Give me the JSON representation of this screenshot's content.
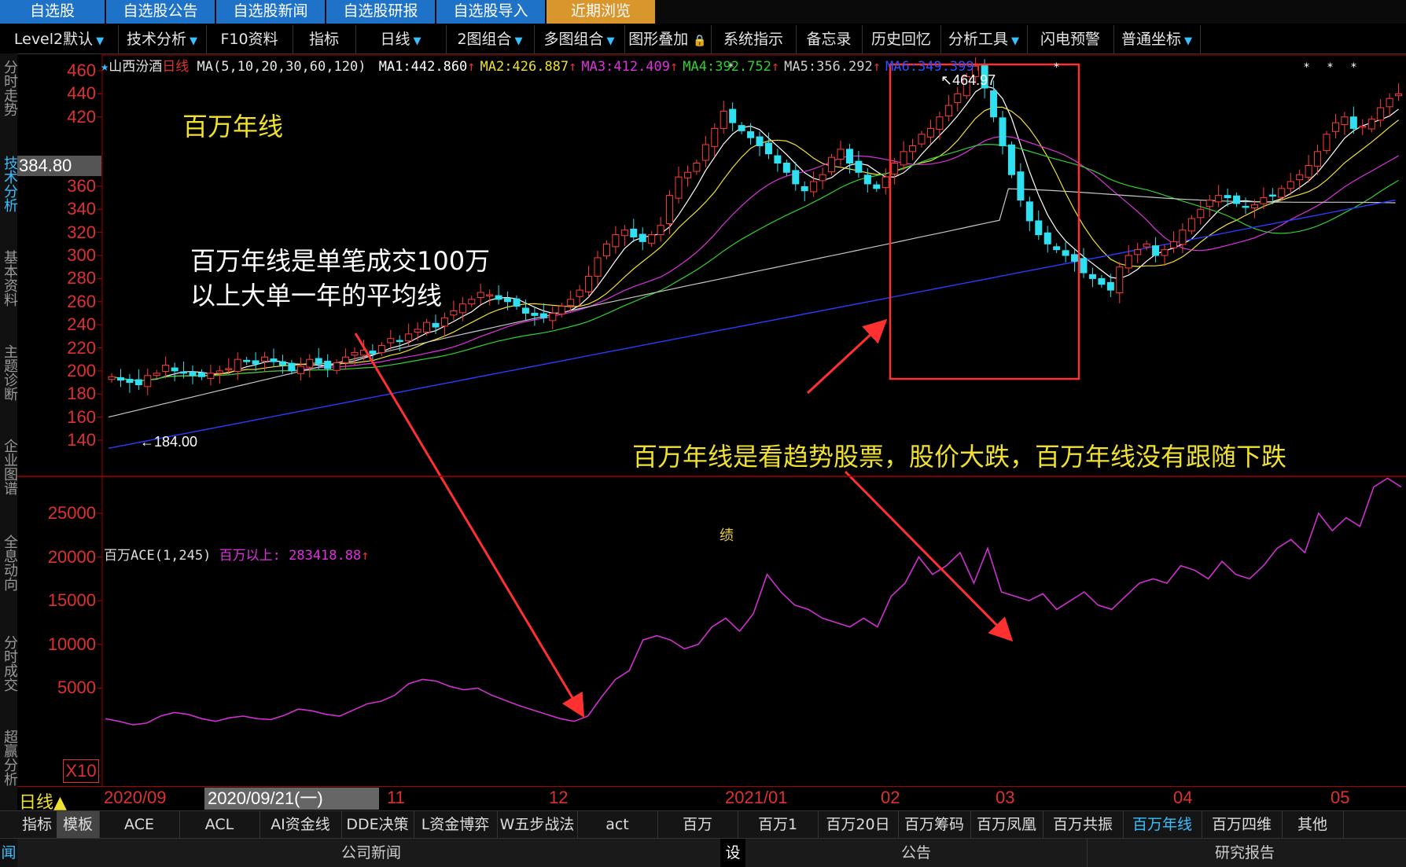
{
  "top_tabs": [
    {
      "label": "自选股",
      "active": false
    },
    {
      "label": "自选股公告",
      "active": false
    },
    {
      "label": "自选股新闻",
      "active": false
    },
    {
      "label": "自选股研报",
      "active": false
    },
    {
      "label": "自选股导入",
      "active": false
    },
    {
      "label": "近期浏览",
      "active": true
    }
  ],
  "toolbar": {
    "items": [
      "Level2默认",
      "技术分析",
      "F10资料",
      "指标",
      "日线",
      "2图组合",
      "多图组合",
      "图形叠加",
      "系统指示",
      "备忘录",
      "历史回忆",
      "分析工具",
      "闪电预警",
      "普通坐标"
    ],
    "lock_glyph": "🔒"
  },
  "left_tabs": [
    {
      "label": "分时走势",
      "active": false
    },
    {
      "label": "技术分析",
      "active": true
    },
    {
      "label": "基本资料",
      "active": false
    },
    {
      "label": "主题诊断",
      "active": false
    },
    {
      "label": "企业图谱",
      "active": false
    },
    {
      "label": "全息动向",
      "active": false
    },
    {
      "label": "分时成交",
      "active": false
    },
    {
      "label": "超赢分析",
      "active": false
    },
    {
      "label": "其他",
      "active": false
    }
  ],
  "stock": {
    "name": "山西汾酒",
    "period": "日线",
    "ma_params": "MA(5,10,20,30,60,120)",
    "ma": [
      {
        "label": "MA1:",
        "value": "442.860",
        "color": "#ffffff"
      },
      {
        "label": "MA2:",
        "value": "426.887",
        "color": "#f0e030"
      },
      {
        "label": "MA3:",
        "value": "412.409",
        "color": "#e030e0"
      },
      {
        "label": "MA4:",
        "value": "392.752",
        "color": "#30d030"
      },
      {
        "label": "MA5:",
        "value": "356.292",
        "color": "#d0d0d0"
      },
      {
        "label": "MA6:",
        "value": "349.399",
        "color": "#3050ff"
      }
    ],
    "current_price_box": "384.80",
    "high_label": "464.97",
    "low_label": "184.00",
    "misc_label": "绩"
  },
  "indicator": {
    "name": "百万ACE(1,245)",
    "series_label": "百万以上:",
    "series_value": "283418.88",
    "scale_marker": "X10"
  },
  "annotations": {
    "title": "百万年线",
    "definition_line1": "百万年线是单笔成交100万",
    "definition_line2": "以上大单一年的平均线",
    "trend_note": "百万年线是看趋势股票，股价大跌，百万年线没有跟随下跌"
  },
  "time_axis": {
    "period_tag": "日线▲",
    "cursor_date": "2020/09/21(一)",
    "labels": [
      "2020/09",
      "11",
      "12",
      "2021/01",
      "02",
      "03",
      "04",
      "05"
    ]
  },
  "bottom_tabs": [
    "指标",
    "模板",
    "ACE",
    "ACL",
    "AI资金线",
    "DDE决策",
    "L资金博弈",
    "W五步战法",
    "act",
    "百万",
    "百万1",
    "百万20日",
    "百万筹码",
    "百万凤凰",
    "百万共振",
    "百万年线",
    "百万四维",
    "其他"
  ],
  "bottom_active": "百万年线",
  "news_bar": {
    "left": "闻",
    "news": "公司新闻",
    "settings": "设",
    "notice": "公告",
    "research": "研究报告"
  },
  "chart_data": [
    {
      "type": "candlestick",
      "title": "",
      "ylim": [
        130,
        470
      ],
      "y_ticks": [
        460,
        440,
        420,
        380,
        360,
        340,
        320,
        300,
        280,
        260,
        240,
        220,
        200,
        180,
        160,
        140
      ],
      "x_labels": [
        "2020/09",
        "11",
        "12",
        "2021/01",
        "02",
        "03",
        "04",
        "05"
      ],
      "note": "daily candles approximated",
      "close_path": [
        195,
        192,
        190,
        188,
        196,
        198,
        205,
        200,
        198,
        196,
        195,
        198,
        200,
        202,
        210,
        208,
        206,
        212,
        208,
        205,
        200,
        204,
        210,
        206,
        202,
        207,
        212,
        216,
        218,
        215,
        222,
        228,
        226,
        232,
        236,
        242,
        238,
        246,
        252,
        258,
        262,
        268,
        266,
        262,
        260,
        256,
        250,
        248,
        246,
        250,
        256,
        262,
        270,
        282,
        298,
        310,
        318,
        322,
        316,
        312,
        318,
        326,
        352,
        368,
        372,
        380,
        396,
        410,
        425,
        415,
        408,
        402,
        395,
        388,
        380,
        372,
        362,
        356,
        364,
        370,
        385,
        392,
        380,
        372,
        362,
        358,
        368,
        380,
        390,
        395,
        405,
        410,
        420,
        430,
        440,
        455,
        464,
        445,
        420,
        395,
        370,
        348,
        330,
        318,
        310,
        305,
        300,
        295,
        285,
        280,
        275,
        270,
        290,
        300,
        305,
        310,
        300,
        305,
        312,
        322,
        332,
        340,
        348,
        352,
        350,
        345,
        342,
        344,
        350,
        352,
        358,
        364,
        370,
        378,
        390,
        405,
        415,
        420,
        410,
        412,
        418,
        428,
        436,
        440
      ]
    },
    {
      "type": "line",
      "title": "",
      "ylim": [
        0,
        30000
      ],
      "y_ticks": [
        25000,
        20000,
        15000,
        10000,
        5000
      ],
      "series": [
        {
          "name": "百万以上",
          "values": [
            1500,
            1200,
            800,
            1000,
            1800,
            2200,
            2000,
            1500,
            1200,
            1600,
            1800,
            1500,
            1400,
            1900,
            2600,
            2400,
            2000,
            1800,
            2500,
            3200,
            3500,
            4200,
            5500,
            6000,
            5800,
            5200,
            4800,
            5000,
            4200,
            3600,
            3000,
            2500,
            2000,
            1500,
            1200,
            1800,
            4000,
            6000,
            7000,
            10500,
            11000,
            10500,
            9500,
            10000,
            12000,
            13000,
            11500,
            13500,
            18000,
            16000,
            14500,
            14000,
            13000,
            12500,
            12000,
            13000,
            12000,
            15500,
            17000,
            20000,
            18000,
            19000,
            20500,
            17000,
            21000,
            16000,
            15500,
            15000,
            15800,
            14000,
            15000,
            16000,
            14500,
            14000,
            15500,
            17000,
            17500,
            17000,
            19000,
            18500,
            17500,
            19500,
            18000,
            17500,
            19000,
            21000,
            22000,
            20500,
            25000,
            23000,
            24500,
            23500,
            28000,
            29000,
            28000
          ]
        }
      ]
    }
  ]
}
